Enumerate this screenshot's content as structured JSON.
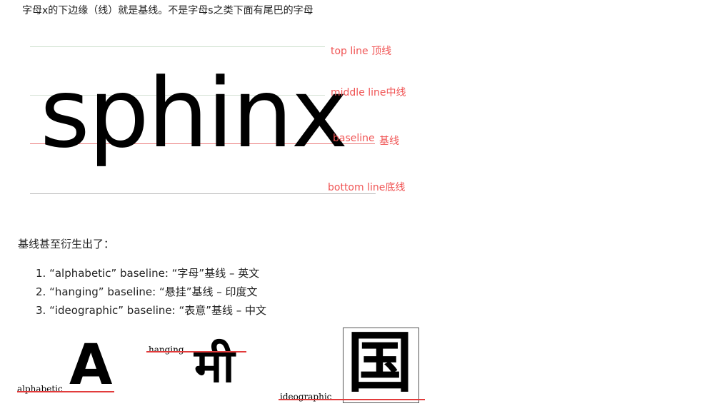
{
  "intro_text": "字母x的下边缘（线）就是基线。不是字母s之类下面有尾巴的字母",
  "figure1": {
    "word": "sphinx",
    "label_top": "top line 顶线",
    "label_middle": "middle line中线",
    "label_baseline": "baseline",
    "label_baseline_cn": "基线",
    "label_bottom": "bottom line底线",
    "label_color": "#f05454"
  },
  "paragraph": "基线甚至衍生出了：",
  "baseline_types": [
    "1. “alphabetic” baseline: “字母”基线 – 英文",
    "2. “hanging” baseline: “悬挂”基线 – 印度文",
    "3. “ideographic” baseline: “表意”基线 – 中文"
  ],
  "figure2": {
    "alphabetic_caption": "alphabetic",
    "alphabetic_glyph": "A",
    "hanging_caption": "hanging",
    "hanging_glyph": "मी",
    "ideographic_caption": "ideographic",
    "ideographic_glyph": "国",
    "line_color": "#e23b3b"
  }
}
